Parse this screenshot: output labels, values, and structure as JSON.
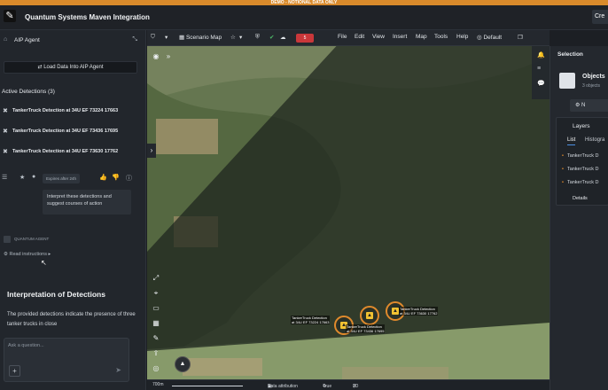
{
  "banner": "DEMO - NOTIONAL DATA ONLY",
  "app": {
    "title": "Quantum Systems Maven Integration",
    "create_label": "Cre"
  },
  "agent": {
    "title": "AIP Agent",
    "load_button": "Load Data Into AIP Agent",
    "detections_header": "Active Detections (3)",
    "detections": [
      "TankerTruck Detection at 34U EF 73224 17663",
      "TankerTruck Detection at 34U EF 73436 17695",
      "TankerTruck Detection at 34U EF 73630 17762"
    ],
    "expires": "Expires after 24h",
    "message": "Interpret these detections and suggest courses of action",
    "agent_label": "QUANTUM AGENT",
    "read_instructions": "Read instructions",
    "interp_title": "Interpretation of Detections",
    "interp_body": "The provided detections indicate the presence of three tanker trucks in close",
    "ask_placeholder": "Ask a question..."
  },
  "map_toolbar": {
    "scenario": "Scenario Map",
    "badge": "5",
    "menus": [
      "File",
      "Edit",
      "View",
      "Insert",
      "Map",
      "Tools",
      "Help"
    ],
    "default_label": "Default"
  },
  "map": {
    "markers": [
      {
        "label_line1": "TankerTruck Detection",
        "label_line2": "at 34U EF 73224 17663"
      },
      {
        "label_line1": "TankerTruck Detection",
        "label_line2": "at 34U EF 73436 17695"
      },
      {
        "label_line1": "TankerTruck Detection",
        "label_line2": "at 34U EF 73630 17762"
      }
    ],
    "footer": {
      "scale": "700m",
      "attribution": "Data attribution",
      "true_label": "True",
      "view_label": "2D"
    }
  },
  "selection": {
    "title": "Selection",
    "objects_title": "Objects",
    "objects_sub": "3 objects",
    "n_button": "N",
    "layers_title": "Layers",
    "tabs": [
      "List",
      "Histogra"
    ],
    "layer_rows": [
      "TankerTruck D",
      "TankerTruck D",
      "TankerTruck D"
    ],
    "details": "Details"
  },
  "colors": {
    "accent": "#e08a2c",
    "banner": "#d98a2b",
    "alert": "#c9373a"
  }
}
